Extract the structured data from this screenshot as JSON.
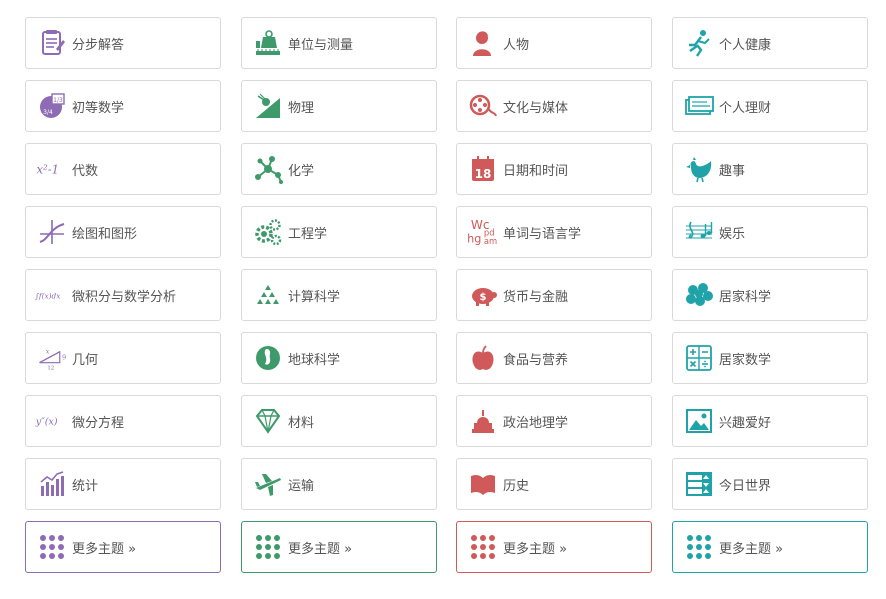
{
  "colors": {
    "purple": "#8e6bb5",
    "green": "#3f9a6b",
    "red": "#d05959",
    "teal": "#1fa3a8",
    "border": "#d9d9d9",
    "text": "#555555"
  },
  "columns": [
    {
      "color_key": "purple",
      "items": [
        {
          "label": "分步解答",
          "icon": "step-by-step-icon"
        },
        {
          "label": "初等数学",
          "icon": "elementary-math-icon"
        },
        {
          "label": "代数",
          "icon": "algebra-icon"
        },
        {
          "label": "绘图和图形",
          "icon": "plotting-graphics-icon"
        },
        {
          "label": "微积分与数学分析",
          "icon": "calculus-icon"
        },
        {
          "label": "几何",
          "icon": "geometry-icon"
        },
        {
          "label": "微分方程",
          "icon": "differential-equations-icon"
        },
        {
          "label": "统计",
          "icon": "statistics-icon"
        }
      ],
      "more_label": "更多主题 »"
    },
    {
      "color_key": "green",
      "items": [
        {
          "label": "单位与测量",
          "icon": "units-measures-icon"
        },
        {
          "label": "物理",
          "icon": "physics-icon"
        },
        {
          "label": "化学",
          "icon": "chemistry-icon"
        },
        {
          "label": "工程学",
          "icon": "engineering-gears-icon"
        },
        {
          "label": "计算科学",
          "icon": "computational-science-icon"
        },
        {
          "label": "地球科学",
          "icon": "earth-science-icon"
        },
        {
          "label": "材料",
          "icon": "materials-diamond-icon"
        },
        {
          "label": "运输",
          "icon": "transportation-plane-icon"
        }
      ],
      "more_label": "更多主题 »"
    },
    {
      "color_key": "red",
      "items": [
        {
          "label": "人物",
          "icon": "people-icon"
        },
        {
          "label": "文化与媒体",
          "icon": "culture-media-film-icon"
        },
        {
          "label": "日期和时间",
          "icon": "dates-calendar-icon"
        },
        {
          "label": "单词与语言学",
          "icon": "words-linguistics-icon"
        },
        {
          "label": "货币与金融",
          "icon": "money-piggy-bank-icon"
        },
        {
          "label": "食品与营养",
          "icon": "food-apple-icon"
        },
        {
          "label": "政治地理学",
          "icon": "political-geography-capitol-icon"
        },
        {
          "label": "历史",
          "icon": "history-book-icon"
        }
      ],
      "more_label": "更多主题 »"
    },
    {
      "color_key": "teal",
      "items": [
        {
          "label": "个人健康",
          "icon": "personal-health-runner-icon"
        },
        {
          "label": "个人理财",
          "icon": "personal-finance-check-icon"
        },
        {
          "label": "趣事",
          "icon": "surprises-chicken-icon"
        },
        {
          "label": "娱乐",
          "icon": "entertainment-music-icon"
        },
        {
          "label": "居家科学",
          "icon": "household-science-icon"
        },
        {
          "label": "居家数学",
          "icon": "household-math-icon"
        },
        {
          "label": "兴趣爱好",
          "icon": "hobbies-picture-icon"
        },
        {
          "label": "今日世界",
          "icon": "todays-world-board-icon"
        }
      ],
      "more_label": "更多主题 »"
    }
  ],
  "icon_text": {
    "algebra": "x²-1",
    "calculus": "∫f(x)dx",
    "diffeq": "y″(x)",
    "geometry_x": "x",
    "geometry_9": "9",
    "geometry_12": "12",
    "elementary_top": "1/3",
    "elementary_bottom": "3/4",
    "calendar_day": "18",
    "words": "Wc hg pd am"
  }
}
